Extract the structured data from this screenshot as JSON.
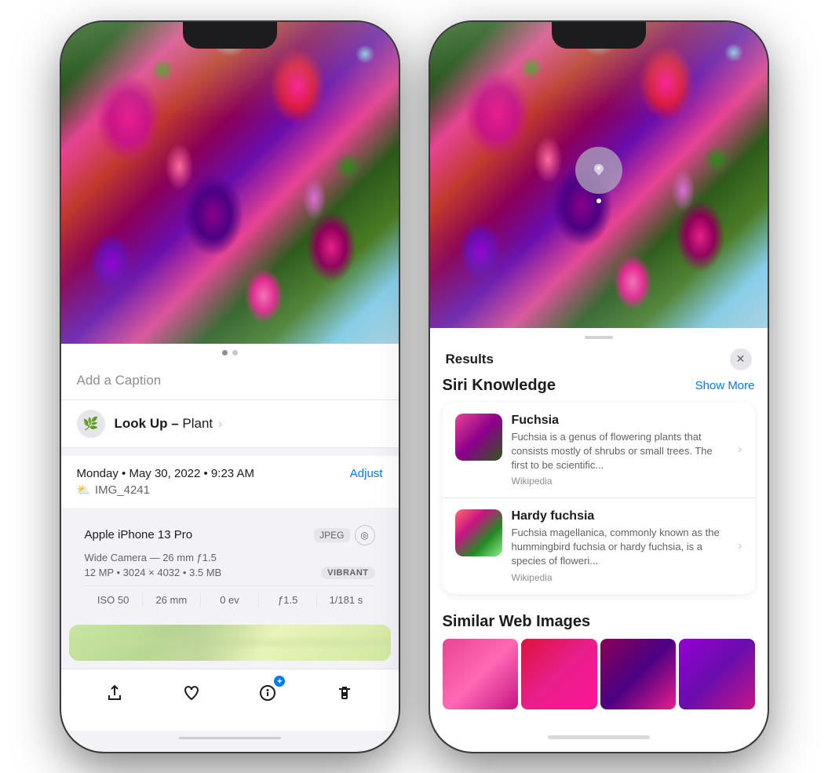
{
  "left_phone": {
    "caption_placeholder": "Add a Caption",
    "lookup_label": "Look Up –",
    "lookup_subject": "Plant",
    "date": "Monday • May 30, 2022 • 9:23 AM",
    "adjust_btn": "Adjust",
    "filename": "IMG_4241",
    "device_name": "Apple iPhone 13 Pro",
    "format_badge": "JPEG",
    "camera_details": "Wide Camera — 26 mm ƒ1.5",
    "file_info": "12 MP • 3024 × 4032 • 3.5 MB",
    "vibrant_badge": "VIBRANT",
    "exif": {
      "iso": "ISO 50",
      "focal": "26 mm",
      "ev": "0 ev",
      "aperture": "ƒ1.5",
      "shutter": "1/181 s"
    },
    "toolbar": {
      "share": "⬆",
      "heart": "♡",
      "info": "ℹ",
      "delete": "🗑"
    }
  },
  "right_phone": {
    "results_title": "Results",
    "siri_section_title": "Siri Knowledge",
    "show_more_btn": "Show More",
    "items": [
      {
        "name": "Fuchsia",
        "description": "Fuchsia is a genus of flowering plants that consists mostly of shrubs or small trees. The first to be scientific...",
        "source": "Wikipedia"
      },
      {
        "name": "Hardy fuchsia",
        "description": "Fuchsia magellanica, commonly known as the hummingbird fuchsia or hardy fuchsia, is a species of floweri...",
        "source": "Wikipedia"
      }
    ],
    "similar_title": "Similar Web Images"
  }
}
